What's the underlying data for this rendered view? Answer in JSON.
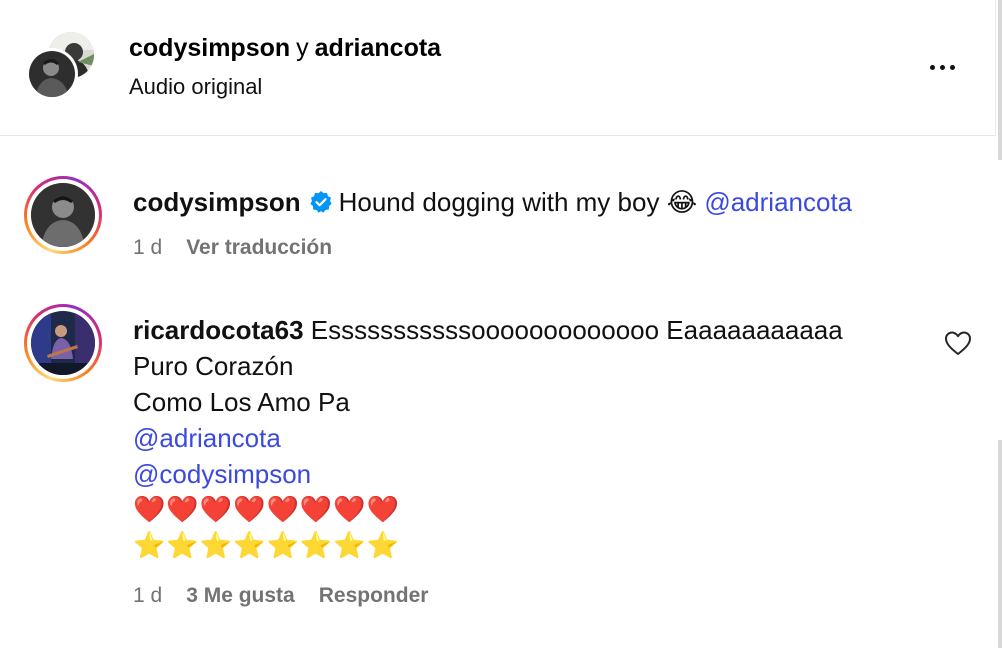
{
  "header": {
    "user1": "codysimpson",
    "conjunction": "y",
    "user2": "adriancota",
    "subtitle": "Audio original"
  },
  "caption": {
    "username": "codysimpson",
    "text": "Hound dogging with my boy",
    "emoji": "😂",
    "mention": "@adriancota",
    "time": "1 d",
    "translate_label": "Ver traducción"
  },
  "comment": {
    "username": "ricardocota63",
    "line1": "Esssssssssssooooooooooooo Eaaaaaaaaaaa",
    "line2": "Puro Corazón",
    "line3": "Como Los Amo Pa",
    "mention1": "@adriancota",
    "mention2": "@codysimpson",
    "hearts": "❤️❤️❤️❤️❤️❤️❤️❤️",
    "stars": "⭐⭐⭐⭐⭐⭐⭐⭐",
    "time": "1 d",
    "likes_label": "3 Me gusta",
    "reply_label": "Responder"
  },
  "colors": {
    "mention": "#3b49df",
    "meta": "#737373",
    "verified": "#0095f6"
  }
}
